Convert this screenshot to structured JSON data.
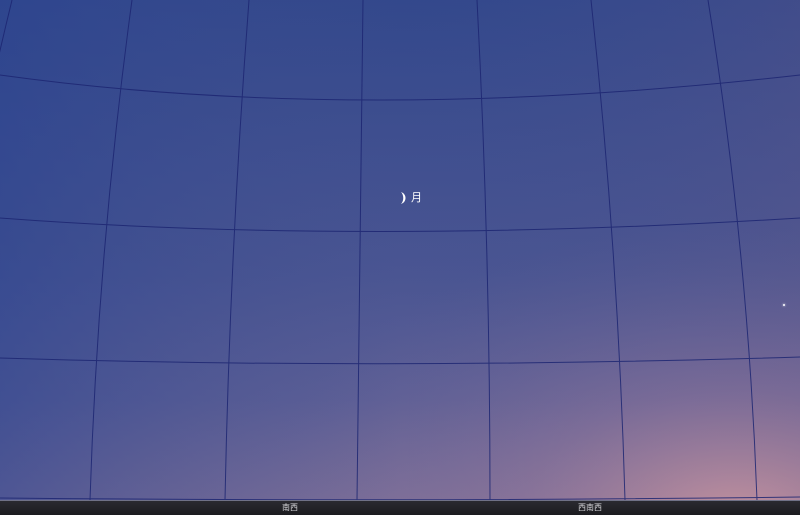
{
  "sky": {
    "colors": {
      "top_left": "#2f4a8e",
      "top_right": "#4a5490",
      "bottom_left": "#3c4f90",
      "bottom_right": "#b88ba2",
      "grid_line": "#1c2470"
    }
  },
  "moon": {
    "label": "月",
    "icon": "crescent-moon-icon"
  },
  "horizon": {
    "directions": [
      "南西",
      "西南西"
    ]
  }
}
